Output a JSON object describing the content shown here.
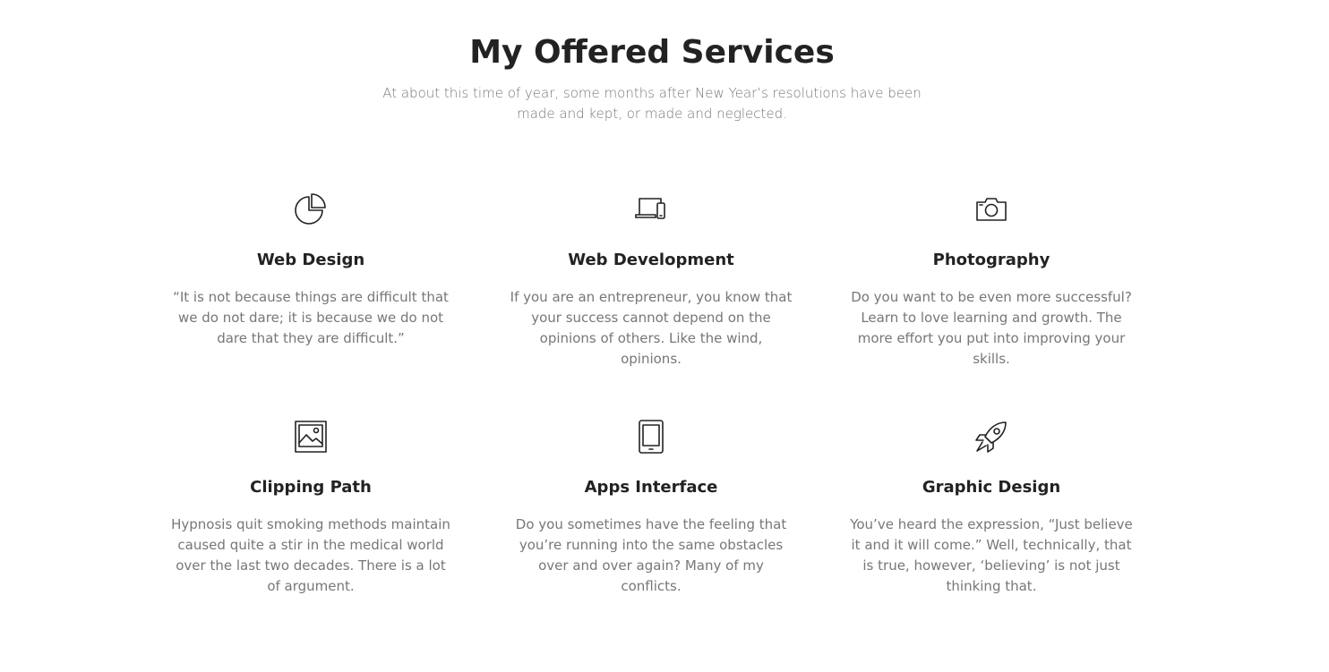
{
  "section": {
    "title": "My Offered Services",
    "subtitle": "At about this time of year, some months after New Year’s resolutions have been made and kept, or made and neglected."
  },
  "services": [
    {
      "icon": "pie-chart-icon",
      "title": "Web Design",
      "description": "“It is not because things are difficult that we do not dare; it is because we do not dare that they are difficult.”"
    },
    {
      "icon": "laptop-phone-icon",
      "title": "Web Development",
      "description": "If you are an entrepreneur, you know that your success cannot depend on the opinions of others. Like the wind, opinions."
    },
    {
      "icon": "camera-icon",
      "title": "Photography",
      "description": "Do you want to be even more successful? Learn to love learning and growth. The more effort you put into improving your skills."
    },
    {
      "icon": "image-icon",
      "title": "Clipping Path",
      "description": "Hypnosis quit smoking methods maintain caused quite a stir in the medical world over the last two decades. There is a lot of argument."
    },
    {
      "icon": "tablet-icon",
      "title": "Apps Interface",
      "description": "Do you sometimes have the feeling that you’re running into the same obstacles over and over again? Many of my conflicts."
    },
    {
      "icon": "rocket-icon",
      "title": "Graphic Design",
      "description": "You’ve heard the expression, “Just believe it and it will come.” Well, technically, that is true, however, ‘believing’ is not just thinking that."
    }
  ],
  "colors": {
    "heading": "#222222",
    "body_text": "#777777",
    "background": "#ffffff"
  }
}
